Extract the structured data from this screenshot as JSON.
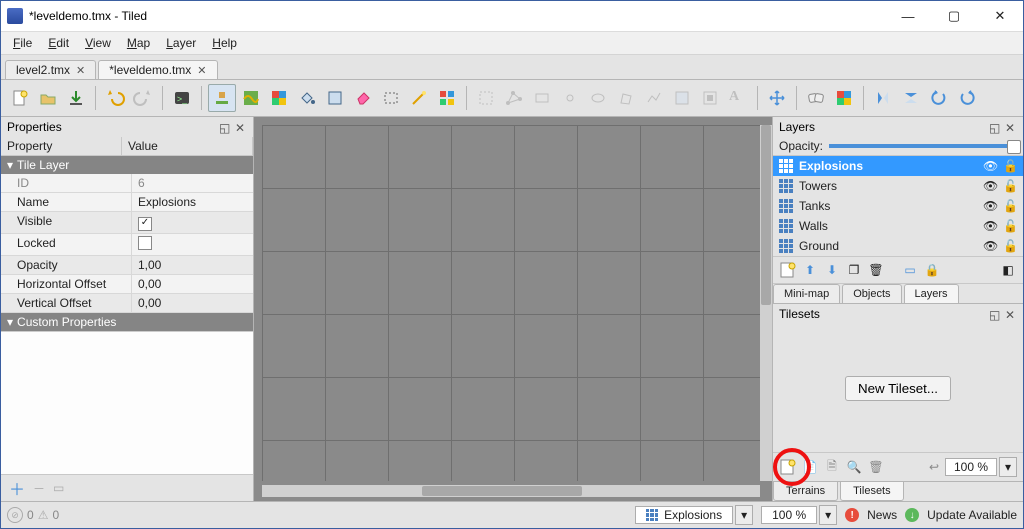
{
  "window": {
    "title": "*leveldemo.tmx - Tiled"
  },
  "menu": {
    "file": "File",
    "edit": "Edit",
    "view": "View",
    "map": "Map",
    "layer": "Layer",
    "help": "Help"
  },
  "tabs": [
    {
      "label": "level2.tmx",
      "active": false
    },
    {
      "label": "*leveldemo.tmx",
      "active": true
    }
  ],
  "properties": {
    "title": "Properties",
    "col_key": "Property",
    "col_val": "Value",
    "section1": "Tile Layer",
    "rows": {
      "id": {
        "k": "ID",
        "v": "6"
      },
      "name": {
        "k": "Name",
        "v": "Explosions"
      },
      "visible": {
        "k": "Visible",
        "v": true
      },
      "locked": {
        "k": "Locked",
        "v": false
      },
      "opacity": {
        "k": "Opacity",
        "v": "1,00"
      },
      "hoff": {
        "k": "Horizontal Offset",
        "v": "0,00"
      },
      "voff": {
        "k": "Vertical Offset",
        "v": "0,00"
      }
    },
    "section2": "Custom Properties"
  },
  "layers": {
    "title": "Layers",
    "opacity_label": "Opacity:",
    "items": [
      {
        "name": "Explosions",
        "selected": true
      },
      {
        "name": "Towers",
        "selected": false
      },
      {
        "name": "Tanks",
        "selected": false
      },
      {
        "name": "Walls",
        "selected": false
      },
      {
        "name": "Ground",
        "selected": false
      }
    ],
    "tabs": {
      "mini": "Mini-map",
      "objects": "Objects",
      "layers": "Layers"
    }
  },
  "tilesets": {
    "title": "Tilesets",
    "new_button": "New Tileset...",
    "zoom": "100 %",
    "tabs": {
      "terrains": "Terrains",
      "tilesets": "Tilesets"
    }
  },
  "status": {
    "err_count": "0",
    "warn_count": "0",
    "layer_selector": "Explosions",
    "zoom": "100 %",
    "news": "News",
    "update": "Update Available"
  }
}
